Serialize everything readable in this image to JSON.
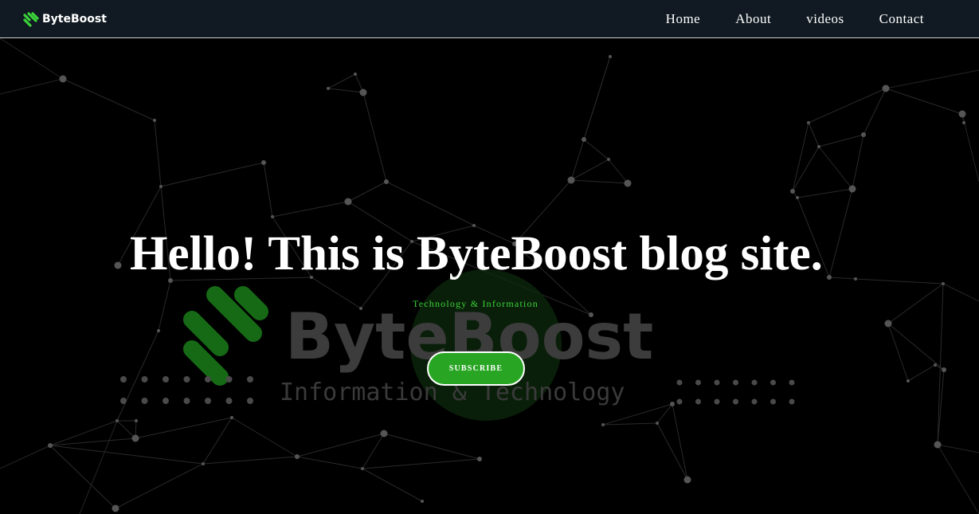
{
  "brand": {
    "name": "ByteBoost",
    "logo_icon": "byteboost-stripes-icon"
  },
  "nav": {
    "items": [
      "Home",
      "About",
      "videos",
      "Contact"
    ]
  },
  "hero": {
    "title": "Hello! This is ByteBoost blog site.",
    "subtitle": "Technology & Information",
    "button": "SUBSCRIBE",
    "watermark_logo": {
      "name": "ByteBoost",
      "tagline": "Information & Technology"
    },
    "background": "network-mesh"
  },
  "colors": {
    "navbar": "#111a22",
    "accent": "#27a523",
    "accent_text": "#39d33a",
    "background": "#000000",
    "text": "#ffffff"
  }
}
